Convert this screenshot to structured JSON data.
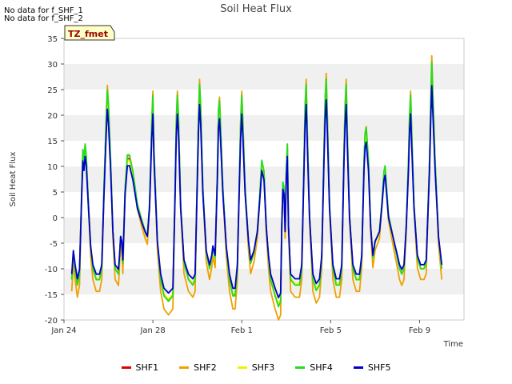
{
  "notes": [
    "No data for f_SHF_1",
    "No data for f_SHF_2"
  ],
  "badge": "TZ_fmet",
  "chart_data": {
    "type": "line",
    "title": "Soil Heat Flux",
    "xlabel": "Time",
    "ylabel": "Soil Heat Flux",
    "ylim": [
      -20,
      35
    ],
    "yticks": [
      -20,
      -15,
      -10,
      -5,
      0,
      5,
      10,
      15,
      20,
      25,
      30,
      35
    ],
    "xlim": [
      0,
      18
    ],
    "xticks": [
      {
        "value": 0,
        "label": "Jan 24"
      },
      {
        "value": 4,
        "label": "Jan 28"
      },
      {
        "value": 8,
        "label": "Feb 1"
      },
      {
        "value": 12,
        "label": "Feb 5"
      },
      {
        "value": 16,
        "label": "Feb 9"
      }
    ],
    "grid": "horizontal bands",
    "legend_position": "bottom",
    "series": [
      {
        "name": "SHF1",
        "color": "#dd0000",
        "offset": 0.3,
        "scale": 1.02
      },
      {
        "name": "SHF2",
        "color": "#f0a000",
        "offset": -0.6,
        "scale": 1.15
      },
      {
        "name": "SHF3",
        "color": "#f0f000",
        "offset": 0.1,
        "scale": 1.0
      },
      {
        "name": "SHF4",
        "color": "#22dd22",
        "offset": 0.6,
        "scale": 1.06
      },
      {
        "name": "SHF5",
        "color": "#0000cc",
        "offset": 0.0,
        "scale": 0.92
      }
    ],
    "base_points": [
      [
        0.35,
        -12
      ],
      [
        0.42,
        -7
      ],
      [
        0.5,
        -10
      ],
      [
        0.6,
        -13
      ],
      [
        0.7,
        -11
      ],
      [
        0.8,
        5
      ],
      [
        0.85,
        12
      ],
      [
        0.9,
        10
      ],
      [
        0.95,
        13
      ],
      [
        1.0,
        11
      ],
      [
        1.1,
        2
      ],
      [
        1.2,
        -6
      ],
      [
        1.3,
        -10
      ],
      [
        1.45,
        -12
      ],
      [
        1.6,
        -12
      ],
      [
        1.7,
        -10
      ],
      [
        1.8,
        5
      ],
      [
        1.9,
        18
      ],
      [
        1.95,
        23
      ],
      [
        2.0,
        20
      ],
      [
        2.1,
        10
      ],
      [
        2.2,
        -3
      ],
      [
        2.3,
        -10
      ],
      [
        2.45,
        -11
      ],
      [
        2.5,
        -8
      ],
      [
        2.55,
        -4
      ],
      [
        2.6,
        -5
      ],
      [
        2.65,
        -9
      ],
      [
        2.75,
        5
      ],
      [
        2.85,
        11
      ],
      [
        2.95,
        11
      ],
      [
        3.1,
        8
      ],
      [
        3.3,
        2
      ],
      [
        3.5,
        -1
      ],
      [
        3.65,
        -3
      ],
      [
        3.75,
        -4
      ],
      [
        3.85,
        2
      ],
      [
        3.95,
        17
      ],
      [
        4.0,
        22
      ],
      [
        4.05,
        12
      ],
      [
        4.2,
        -5
      ],
      [
        4.35,
        -12
      ],
      [
        4.5,
        -15
      ],
      [
        4.7,
        -16
      ],
      [
        4.9,
        -15
      ],
      [
        5.0,
        5
      ],
      [
        5.05,
        17
      ],
      [
        5.1,
        22
      ],
      [
        5.15,
        18
      ],
      [
        5.25,
        2
      ],
      [
        5.4,
        -9
      ],
      [
        5.6,
        -12
      ],
      [
        5.8,
        -13
      ],
      [
        5.9,
        -12
      ],
      [
        6.0,
        8
      ],
      [
        6.05,
        18
      ],
      [
        6.1,
        24
      ],
      [
        6.15,
        20
      ],
      [
        6.25,
        5
      ],
      [
        6.4,
        -7
      ],
      [
        6.55,
        -10
      ],
      [
        6.65,
        -8
      ],
      [
        6.7,
        -6
      ],
      [
        6.8,
        -8
      ],
      [
        6.9,
        8
      ],
      [
        6.95,
        19
      ],
      [
        7.0,
        21
      ],
      [
        7.05,
        16
      ],
      [
        7.15,
        5
      ],
      [
        7.3,
        -6
      ],
      [
        7.45,
        -12
      ],
      [
        7.6,
        -15
      ],
      [
        7.7,
        -15
      ],
      [
        7.8,
        -10
      ],
      [
        7.9,
        8
      ],
      [
        7.95,
        17
      ],
      [
        8.0,
        22
      ],
      [
        8.05,
        17
      ],
      [
        8.15,
        5
      ],
      [
        8.3,
        -5
      ],
      [
        8.4,
        -9
      ],
      [
        8.55,
        -7
      ],
      [
        8.7,
        -3
      ],
      [
        8.8,
        3
      ],
      [
        8.9,
        10
      ],
      [
        9.0,
        8
      ],
      [
        9.1,
        -2
      ],
      [
        9.2,
        -8
      ],
      [
        9.3,
        -12
      ],
      [
        9.5,
        -15
      ],
      [
        9.65,
        -17
      ],
      [
        9.75,
        -16
      ],
      [
        9.8,
        -2
      ],
      [
        9.85,
        6
      ],
      [
        9.9,
        5
      ],
      [
        9.95,
        -3
      ],
      [
        10.0,
        8
      ],
      [
        10.05,
        13
      ],
      [
        10.1,
        -2
      ],
      [
        10.2,
        -12
      ],
      [
        10.4,
        -13
      ],
      [
        10.6,
        -13
      ],
      [
        10.7,
        -10
      ],
      [
        10.8,
        10
      ],
      [
        10.85,
        20
      ],
      [
        10.9,
        24
      ],
      [
        10.95,
        15
      ],
      [
        11.05,
        0
      ],
      [
        11.2,
        -12
      ],
      [
        11.35,
        -14
      ],
      [
        11.5,
        -13
      ],
      [
        11.6,
        -8
      ],
      [
        11.7,
        12
      ],
      [
        11.75,
        21
      ],
      [
        11.8,
        25
      ],
      [
        11.85,
        18
      ],
      [
        11.95,
        2
      ],
      [
        12.1,
        -10
      ],
      [
        12.25,
        -13
      ],
      [
        12.4,
        -13
      ],
      [
        12.5,
        -10
      ],
      [
        12.6,
        12
      ],
      [
        12.65,
        20
      ],
      [
        12.7,
        24
      ],
      [
        12.75,
        15
      ],
      [
        12.85,
        0
      ],
      [
        13.0,
        -10
      ],
      [
        13.15,
        -12
      ],
      [
        13.3,
        -12
      ],
      [
        13.4,
        -8
      ],
      [
        13.5,
        10
      ],
      [
        13.55,
        15
      ],
      [
        13.6,
        16
      ],
      [
        13.7,
        10
      ],
      [
        13.8,
        -2
      ],
      [
        13.9,
        -8
      ],
      [
        14.0,
        -5
      ],
      [
        14.1,
        -4
      ],
      [
        14.2,
        -3
      ],
      [
        14.3,
        2
      ],
      [
        14.4,
        8
      ],
      [
        14.45,
        9
      ],
      [
        14.5,
        6
      ],
      [
        14.6,
        0
      ],
      [
        14.8,
        -4
      ],
      [
        14.9,
        -6
      ],
      [
        15.0,
        -8
      ],
      [
        15.1,
        -10
      ],
      [
        15.2,
        -11
      ],
      [
        15.3,
        -10
      ],
      [
        15.4,
        -2
      ],
      [
        15.5,
        10
      ],
      [
        15.55,
        18
      ],
      [
        15.6,
        22
      ],
      [
        15.65,
        15
      ],
      [
        15.75,
        2
      ],
      [
        15.9,
        -8
      ],
      [
        16.05,
        -10
      ],
      [
        16.2,
        -10
      ],
      [
        16.3,
        -9
      ],
      [
        16.45,
        10
      ],
      [
        16.5,
        20
      ],
      [
        16.55,
        28
      ],
      [
        16.6,
        22
      ],
      [
        16.7,
        10
      ],
      [
        16.85,
        -4
      ],
      [
        17.0,
        -10
      ]
    ]
  }
}
